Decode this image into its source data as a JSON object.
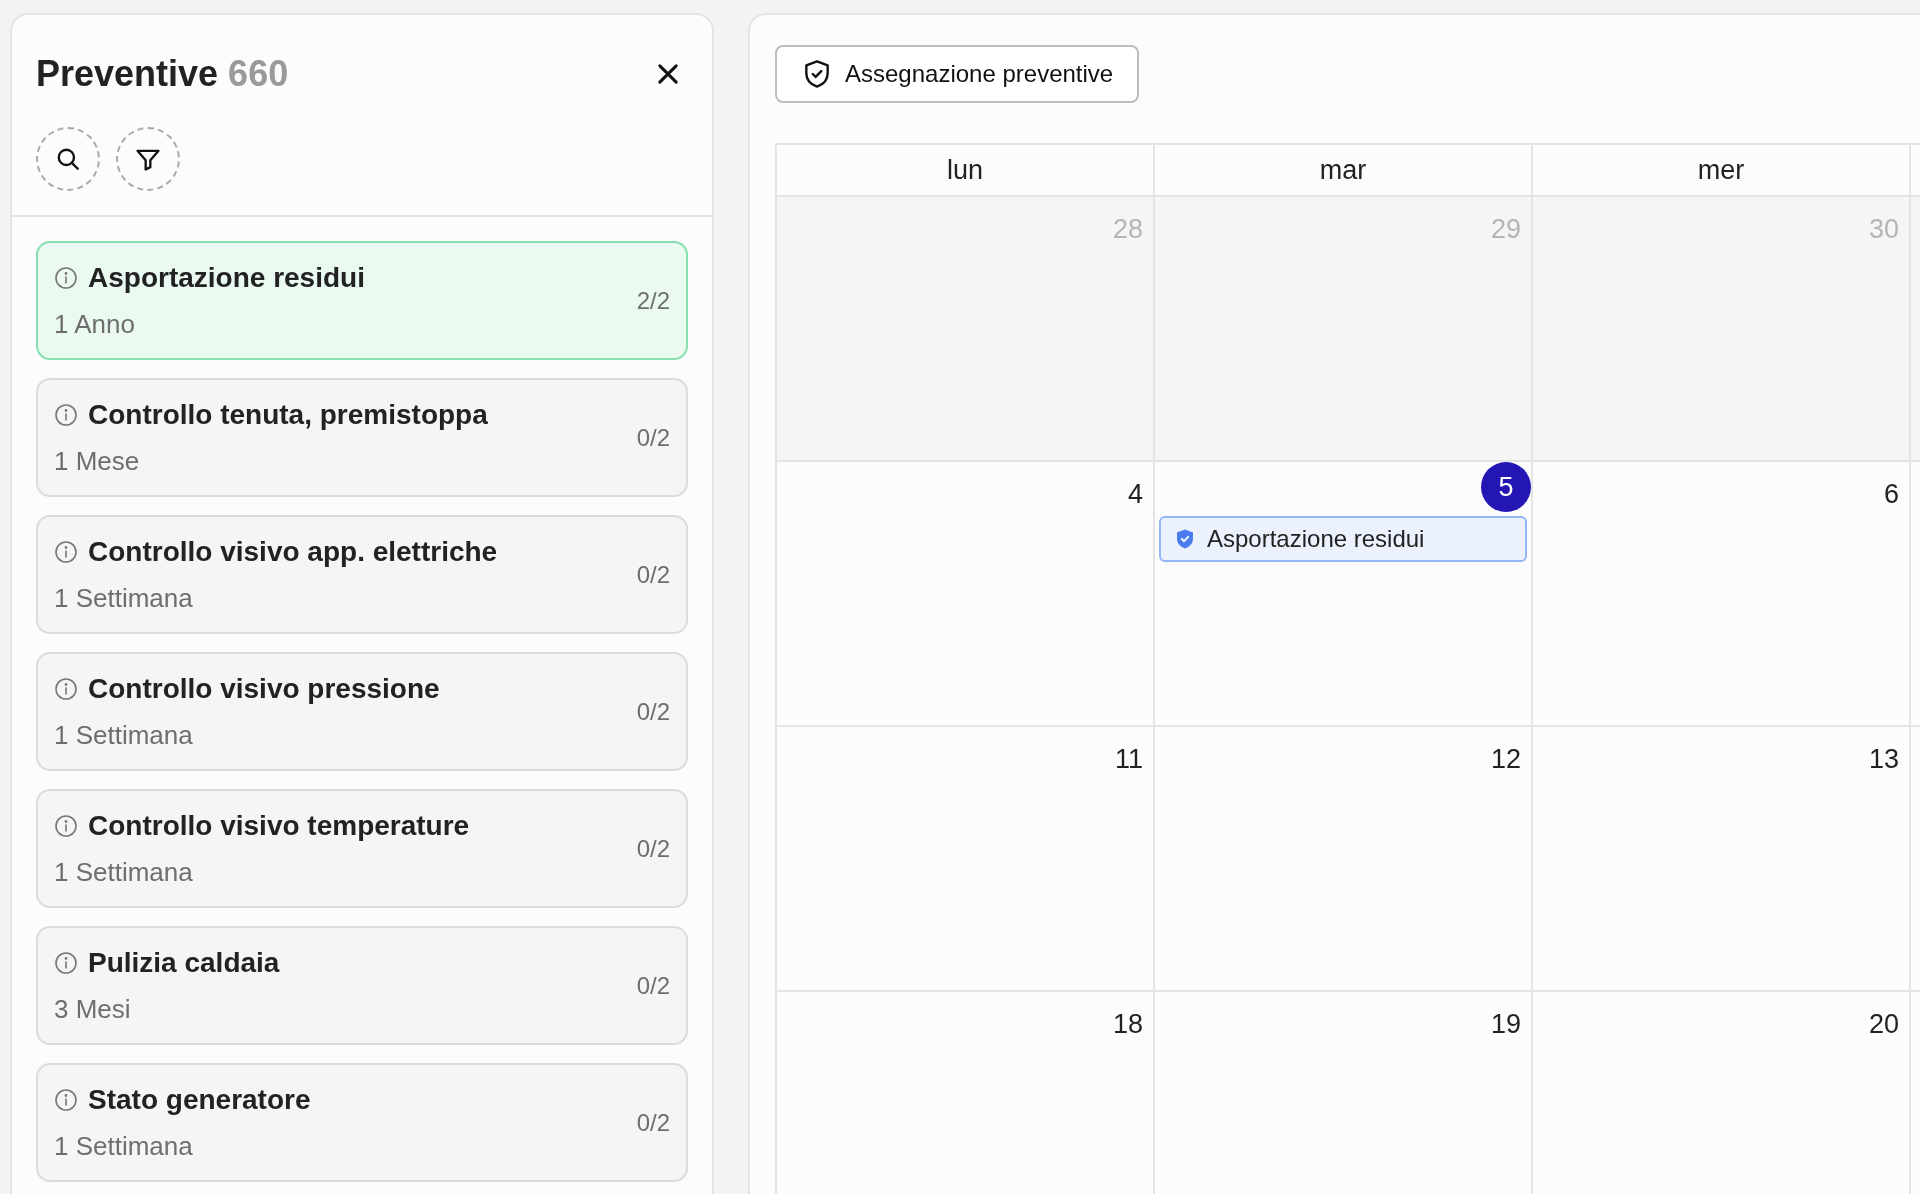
{
  "panel": {
    "title": "Preventive",
    "count": "660"
  },
  "tasks": [
    {
      "title": "Asportazione residui",
      "frequency": "1 Anno",
      "progress": "2/2",
      "selected": true
    },
    {
      "title": "Controllo tenuta, premistoppa",
      "frequency": "1 Mese",
      "progress": "0/2",
      "selected": false
    },
    {
      "title": "Controllo visivo app. elettriche",
      "frequency": "1 Settimana",
      "progress": "0/2",
      "selected": false
    },
    {
      "title": "Controllo visivo pressione",
      "frequency": "1 Settimana",
      "progress": "0/2",
      "selected": false
    },
    {
      "title": "Controllo visivo temperature",
      "frequency": "1 Settimana",
      "progress": "0/2",
      "selected": false
    },
    {
      "title": "Pulizia caldaia",
      "frequency": "3 Mesi",
      "progress": "0/2",
      "selected": false
    },
    {
      "title": "Stato generatore",
      "frequency": "1 Settimana",
      "progress": "0/2",
      "selected": false
    }
  ],
  "calendar": {
    "assign_button": "Assegnazione preventive",
    "weekdays": [
      "lun",
      "mar",
      "mer"
    ],
    "weeks": [
      [
        {
          "label": "28",
          "outside_month": true,
          "today": false
        },
        {
          "label": "29",
          "outside_month": true,
          "today": false
        },
        {
          "label": "30",
          "outside_month": true,
          "today": false
        }
      ],
      [
        {
          "label": "4",
          "outside_month": false,
          "today": false
        },
        {
          "label": "5",
          "outside_month": false,
          "today": true,
          "events": [
            "Asportazione residui"
          ]
        },
        {
          "label": "6",
          "outside_month": false,
          "today": false
        }
      ],
      [
        {
          "label": "11",
          "outside_month": false,
          "today": false
        },
        {
          "label": "12",
          "outside_month": false,
          "today": false
        },
        {
          "label": "13",
          "outside_month": false,
          "today": false
        }
      ],
      [
        {
          "label": "18",
          "outside_month": false,
          "today": false
        },
        {
          "label": "19",
          "outside_month": false,
          "today": false
        },
        {
          "label": "20",
          "outside_month": false,
          "today": false
        }
      ]
    ]
  }
}
